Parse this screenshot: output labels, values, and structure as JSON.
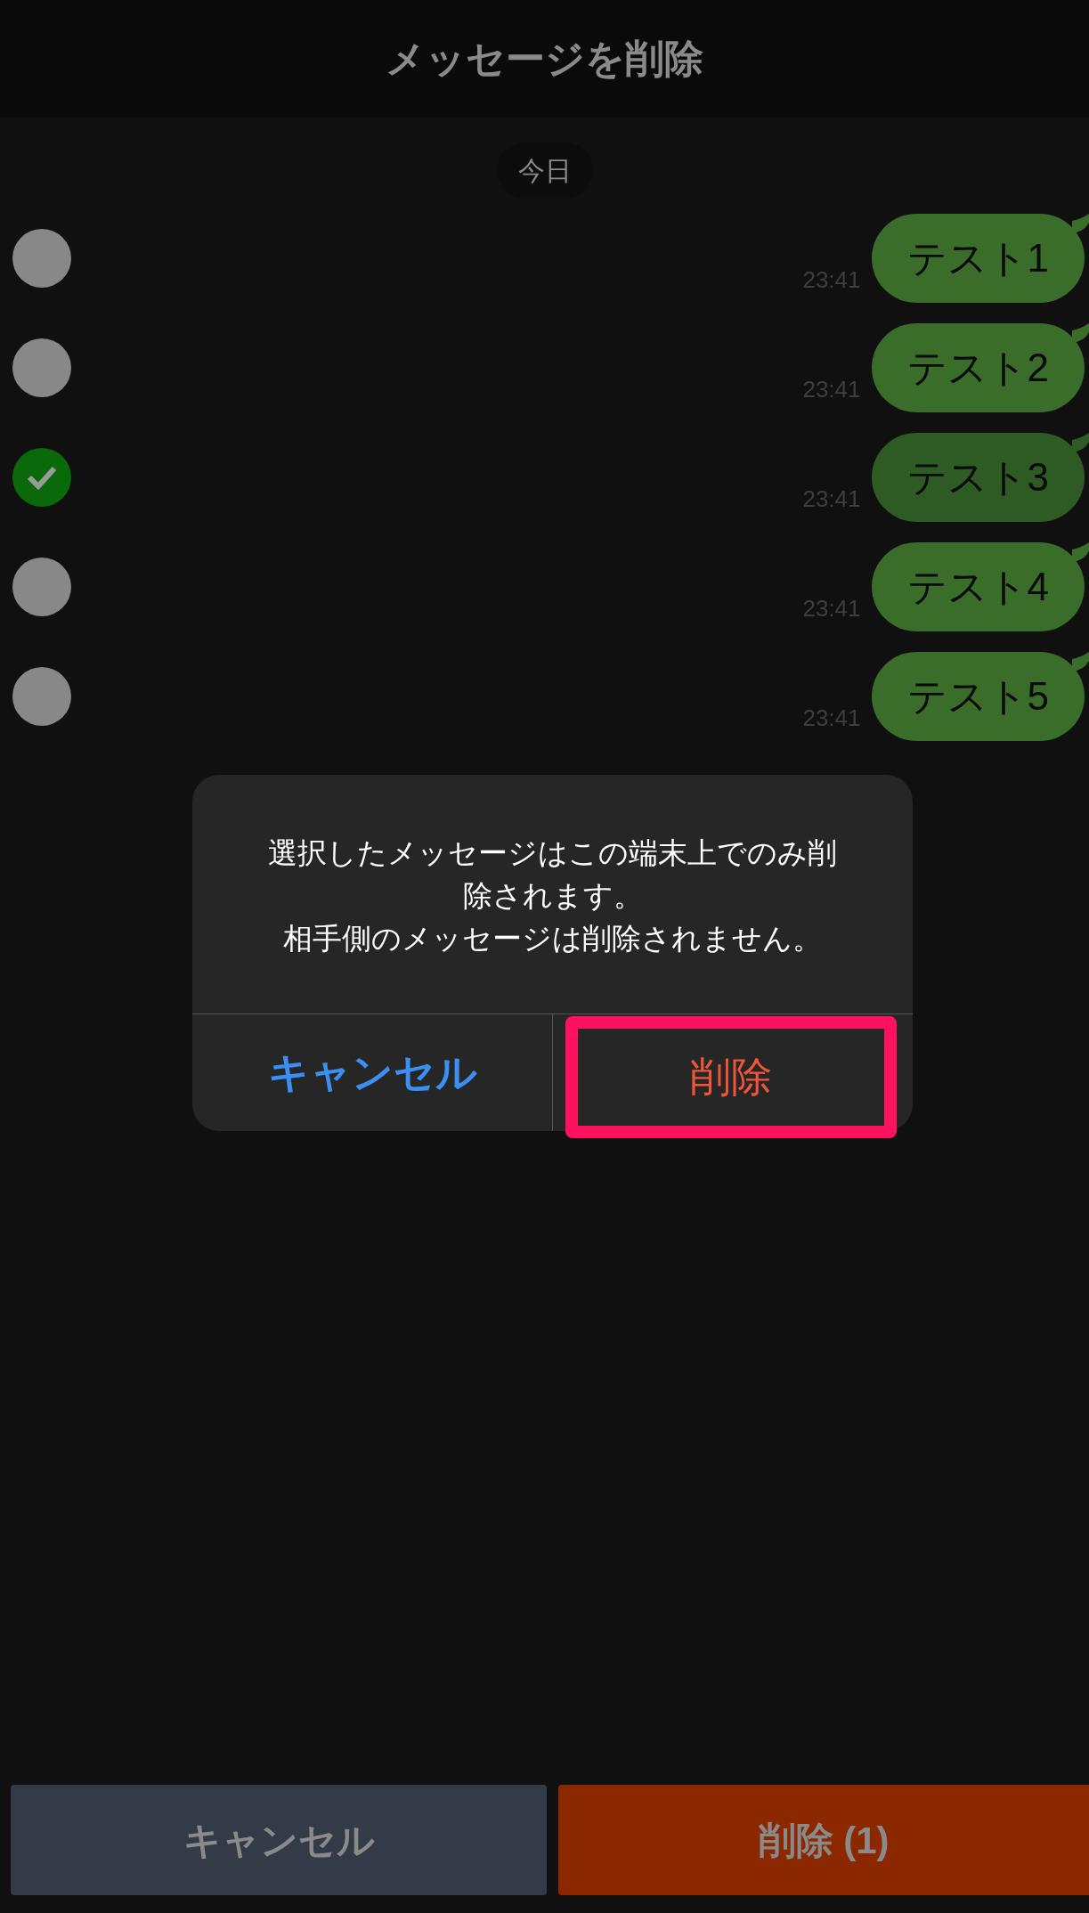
{
  "header": {
    "title": "メッセージを削除"
  },
  "date_label": "今日",
  "messages": [
    {
      "text": "テスト1",
      "time": "23:41",
      "selected": false
    },
    {
      "text": "テスト2",
      "time": "23:41",
      "selected": false
    },
    {
      "text": "テスト3",
      "time": "23:41",
      "selected": true
    },
    {
      "text": "テスト4",
      "time": "23:41",
      "selected": false
    },
    {
      "text": "テスト5",
      "time": "23:41",
      "selected": false
    }
  ],
  "dialog": {
    "message_lines": [
      "選択したメッセージはこの端末上でのみ削",
      "除されます。",
      "相手側のメッセージは削除されません。"
    ],
    "buttons": [
      {
        "kind": "cancel",
        "label": "キャンセル",
        "highlighted": false
      },
      {
        "kind": "destructive",
        "label": "削除",
        "highlighted": true
      }
    ]
  },
  "bottom_bar": {
    "buttons": [
      {
        "kind": "cancel",
        "label": "キャンセル"
      },
      {
        "kind": "destructive",
        "label": "削除 (1)"
      }
    ]
  }
}
